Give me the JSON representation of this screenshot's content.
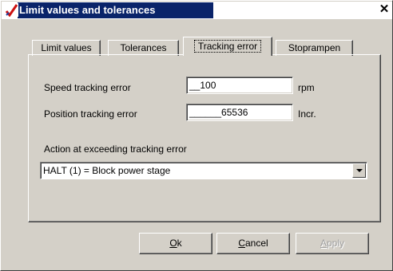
{
  "window": {
    "title": "Limit values and tolerances",
    "icon": "red-check-app-icon",
    "close_icon": "close-icon"
  },
  "tabs": [
    {
      "label": "Limit values",
      "active": false
    },
    {
      "label": "Tolerances",
      "active": false
    },
    {
      "label": "Tracking error",
      "active": true
    },
    {
      "label": "Stoprampen",
      "active": false
    }
  ],
  "speed": {
    "label": "Speed tracking error",
    "value": "__100",
    "unit": "rpm"
  },
  "position": {
    "label": "Position tracking error",
    "value": "______65536",
    "unit": "Incr."
  },
  "action": {
    "label": "Action at exceeding tracking error",
    "selected": "HALT (1) = Block power stage"
  },
  "buttons": {
    "ok": {
      "prefix": "",
      "mnemonic": "O",
      "rest": "k",
      "enabled": true
    },
    "cancel": {
      "prefix": "",
      "mnemonic": "C",
      "rest": "ancel",
      "enabled": true
    },
    "apply": {
      "prefix": "",
      "mnemonic": "A",
      "rest": "pply",
      "enabled": false
    }
  },
  "colors": {
    "title_bar": "#0a246a",
    "dialog_face": "#d4d0c8",
    "disabled_text": "#a0a0a0"
  }
}
